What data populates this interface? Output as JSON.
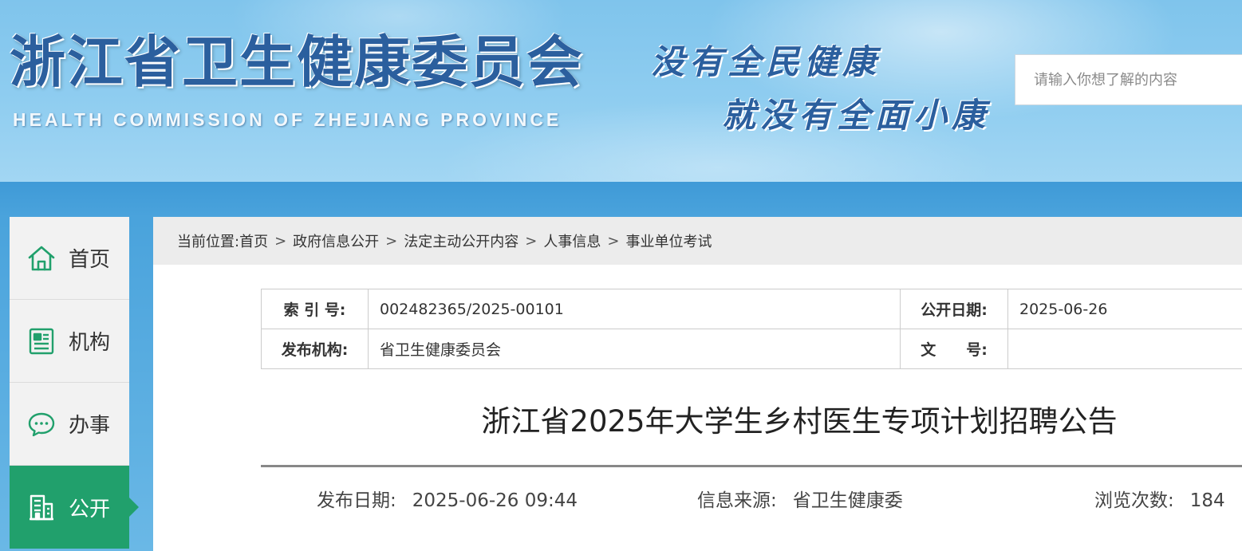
{
  "header": {
    "title": "浙江省卫生健康委员会",
    "subtitle": "HEALTH COMMISSION OF ZHEJIANG PROVINCE",
    "slogan_line1": "没有全民健康",
    "slogan_line2": "就没有全面小康",
    "search_placeholder": "请输入你想了解的内容"
  },
  "sidebar": {
    "items": [
      {
        "label": "首页",
        "icon": "home-icon",
        "active": false
      },
      {
        "label": "机构",
        "icon": "document-icon",
        "active": false
      },
      {
        "label": "办事",
        "icon": "chat-icon",
        "active": false
      },
      {
        "label": "公开",
        "icon": "building-icon",
        "active": true
      }
    ]
  },
  "breadcrumb": {
    "prefix": "当前位置:",
    "items": [
      "首页",
      "政府信息公开",
      "法定主动公开内容",
      "人事信息",
      "事业单位考试"
    ],
    "separator": ">"
  },
  "meta": {
    "index_label": "索 引 号:",
    "index_value": "002482365/2025-00101",
    "pubdate_label": "公开日期:",
    "pubdate_value": "2025-06-26",
    "org_label": "发布机构:",
    "org_value": "省卫生健康委员会",
    "docno_label": "文　　号:",
    "docno_value": ""
  },
  "article": {
    "title": "浙江省2025年大学生乡村医生专项计划招聘公告",
    "date_label": "发布日期:",
    "date_value": "2025-06-26 09:44",
    "source_label": "信息来源:",
    "source_value": "省卫生健康委",
    "views_label": "浏览次数:",
    "views_value": "184"
  },
  "colors": {
    "accent_green": "#21a06c",
    "title_blue": "#2b5f9e",
    "sky_blue": "#4aa3dc"
  }
}
